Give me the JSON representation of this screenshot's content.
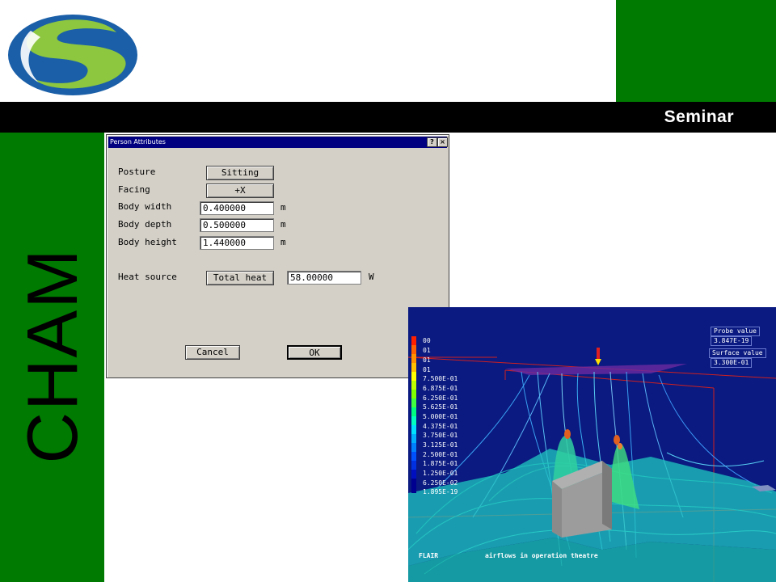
{
  "slide": {
    "band_title": "Seminar",
    "vertical_brand": "CHAM"
  },
  "colors": {
    "brand_green": "#007a00",
    "band_black": "#000000",
    "dialog_face": "#d4d0c8",
    "titlebar": "#000080",
    "viz_background": "#0a1a80"
  },
  "icons": [
    "cham-logo-icon",
    "help-icon",
    "close-icon"
  ],
  "dialog": {
    "title": "Person Attributes",
    "help_glyph": "?",
    "close_glyph": "×",
    "posture_label": "Posture",
    "posture_value": "Sitting",
    "facing_label": "Facing",
    "facing_value": "+X",
    "body_width_label": "Body width",
    "body_width_value": "0.400000",
    "body_width_unit": "m",
    "body_depth_label": "Body depth",
    "body_depth_value": "0.500000",
    "body_depth_unit": "m",
    "body_height_label": "Body height",
    "body_height_value": "1.440000",
    "body_height_unit": "m",
    "heat_source_label": "Heat source",
    "heat_source_mode": "Total heat",
    "heat_value": "58.00000",
    "heat_unit": "W",
    "cancel_label": "Cancel",
    "ok_label": "OK"
  },
  "viz": {
    "scale_labels": [
      "00",
      "01",
      "01",
      "01",
      "7.500E-01",
      "6.875E-01",
      "6.250E-01",
      "5.625E-01",
      "5.000E-01",
      "4.375E-01",
      "3.750E-01",
      "3.125E-01",
      "2.500E-01",
      "1.875E-01",
      "1.250E-01",
      "6.250E-02",
      "1.895E-19"
    ],
    "probe_title": "Probe value",
    "probe_value": "3.847E-19",
    "surface_title": "Surface value",
    "surface_value": "3.300E-01",
    "brand_caption": "FLAIR",
    "scene_caption": "airflows in operation theatre"
  }
}
